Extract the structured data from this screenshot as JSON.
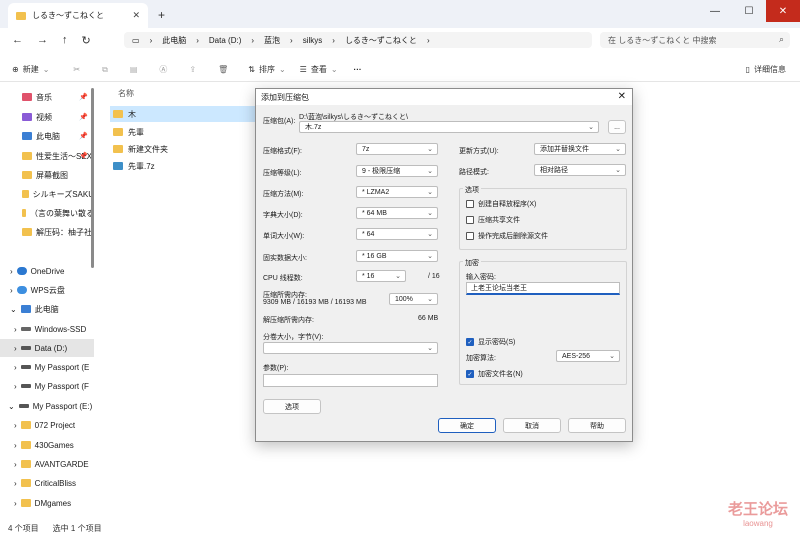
{
  "window": {
    "tab_title": "しるき～ずこねくと",
    "new_tab": "+",
    "min": "—",
    "max": "☐",
    "close": "✕",
    "tab_close": "✕"
  },
  "nav": {
    "back": "←",
    "forward": "→",
    "up": "↑",
    "refresh": "↻"
  },
  "breadcrumb": [
    "此电脑",
    "Data (D:)",
    "蓝泡",
    "silkys",
    "しるき～ずこねくと"
  ],
  "search": {
    "placeholder": "在 しるき～ずこねくと 中搜索"
  },
  "toolbar": {
    "new": "新建",
    "sort": "排序",
    "view": "查看",
    "more": "···",
    "details": "详细信息"
  },
  "sidebar": [
    {
      "label": "音乐",
      "pinned": true
    },
    {
      "label": "视频",
      "pinned": true
    },
    {
      "label": "此电脑",
      "pinned": true
    },
    {
      "label": "性爱生活～SEX",
      "pinned": true
    },
    {
      "label": "屏幕截图",
      "pinned": false
    },
    {
      "label": "シルキーズSAKU",
      "pinned": false
    },
    {
      "label": "（言の葉舞い散る",
      "pinned": false
    },
    {
      "label": "解压码：柚子社",
      "pinned": false
    },
    {
      "label": "OneDrive",
      "pinned": false
    },
    {
      "label": "WPS云盘",
      "pinned": false
    },
    {
      "label": "此电脑",
      "pinned": false
    },
    {
      "label": "Windows-SSD",
      "pinned": false
    },
    {
      "label": "Data (D:)",
      "pinned": false
    },
    {
      "label": "My Passport (E",
      "pinned": false
    },
    {
      "label": "My Passport (F",
      "pinned": false
    },
    {
      "label": "My Passport (E:)",
      "pinned": false
    },
    {
      "label": "072 Project",
      "pinned": false
    },
    {
      "label": "430Games",
      "pinned": false
    },
    {
      "label": "AVANTGARDE",
      "pinned": false
    },
    {
      "label": "CriticalBliss",
      "pinned": false
    },
    {
      "label": "DMgames",
      "pinned": false
    }
  ],
  "filelist": {
    "header": "名称",
    "items": [
      "木",
      "先輩",
      "新建文件夹",
      "先輩.7z"
    ]
  },
  "status": {
    "count": "4 个项目",
    "selected": "选中 1 个项目"
  },
  "dialog": {
    "title": "添加到压缩包",
    "archive_label": "压缩包(A):",
    "archive_path": "D:\\蓝泡\\silkys\\しるき～ずこねくと\\",
    "archive_name": "木.7z",
    "browse": "...",
    "format_label": "压缩格式(F):",
    "format": "7z",
    "level_label": "压缩等级(L):",
    "level": "9 - 极限压缩",
    "method_label": "压缩方法(M):",
    "method": "* LZMA2",
    "dict_label": "字典大小(D):",
    "dict": "* 64 MB",
    "word_label": "单词大小(W):",
    "word": "* 64",
    "solid_label": "固实数据大小:",
    "solid": "* 16 GB",
    "threads_label": "CPU 线程数:",
    "threads": "* 16",
    "threads_max": "/ 16",
    "mem_label": "压缩所需内存:",
    "mem_value": "9309 MB / 16193 MB / 16193 MB",
    "mem_pct": "100%",
    "decomp_label": "解压缩所需内存:",
    "decomp_value": "66 MB",
    "split_label": "分卷大小，字节(V):",
    "params_label": "参数(P):",
    "options_btn": "选项",
    "update_label": "更新方式(U):",
    "update": "添加并替换文件",
    "pathmode_label": "路径模式:",
    "pathmode": "相对路径",
    "opts_group": "选项",
    "opt_sfx": "创建自释放程序(X)",
    "opt_shared": "压缩共享文件",
    "opt_delete": "操作完成后删除源文件",
    "enc_group": "加密",
    "pwd_label": "输入密码:",
    "pwd_value": "上老王论坛当老王",
    "show_pwd": "显示密码(S)",
    "enc_method_label": "加密算法:",
    "enc_method": "AES-256",
    "enc_names": "加密文件名(N)",
    "ok": "确定",
    "cancel": "取消",
    "help": "帮助"
  },
  "watermark": {
    "big": "老王论坛",
    "small": "laowang"
  }
}
